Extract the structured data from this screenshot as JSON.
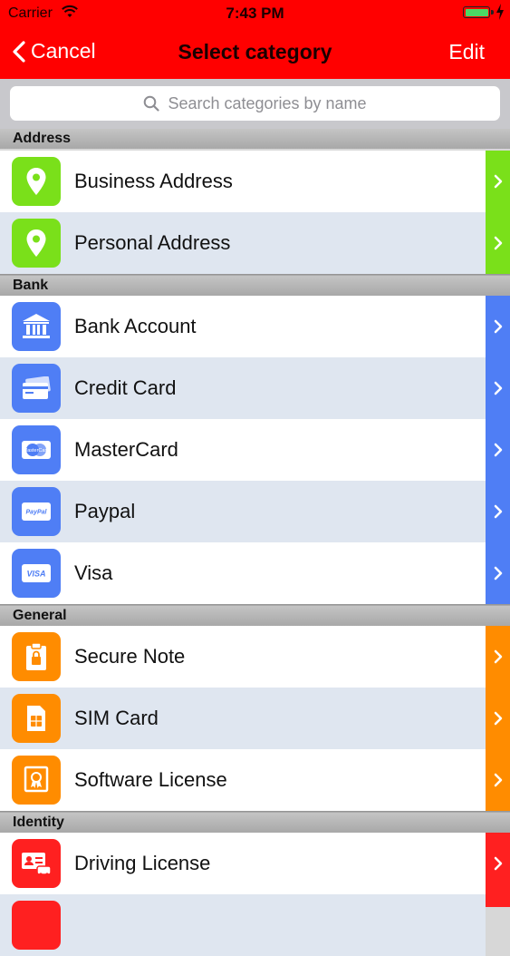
{
  "status_bar": {
    "carrier": "Carrier",
    "time": "7:43 PM"
  },
  "nav": {
    "back_label": "Cancel",
    "title": "Select category",
    "edit_label": "Edit"
  },
  "search": {
    "placeholder": "Search categories by name"
  },
  "colors": {
    "address": "#7ae01a",
    "bank": "#4f7ef5",
    "general": "#ff8c00",
    "identity": "#ff2020",
    "header_bg": "#ff0000"
  },
  "sections": [
    {
      "title": "Address",
      "items": [
        {
          "label": "Business Address",
          "icon": "map-pin-icon"
        },
        {
          "label": "Personal Address",
          "icon": "map-pin-icon"
        }
      ]
    },
    {
      "title": "Bank",
      "items": [
        {
          "label": "Bank Account",
          "icon": "bank-icon"
        },
        {
          "label": "Credit Card",
          "icon": "credit-card-icon"
        },
        {
          "label": "MasterCard",
          "icon": "mastercard-icon"
        },
        {
          "label": "Paypal",
          "icon": "paypal-icon"
        },
        {
          "label": "Visa",
          "icon": "visa-icon"
        }
      ]
    },
    {
      "title": "General",
      "items": [
        {
          "label": "Secure Note",
          "icon": "secure-note-icon"
        },
        {
          "label": "SIM Card",
          "icon": "sim-card-icon"
        },
        {
          "label": "Software License",
          "icon": "certificate-icon"
        }
      ]
    },
    {
      "title": "Identity",
      "items": [
        {
          "label": "Driving License",
          "icon": "driving-license-icon"
        }
      ]
    }
  ],
  "icon_text": {
    "mastercard": "MasterCard",
    "paypal": "PayPal",
    "visa": "VISA"
  }
}
